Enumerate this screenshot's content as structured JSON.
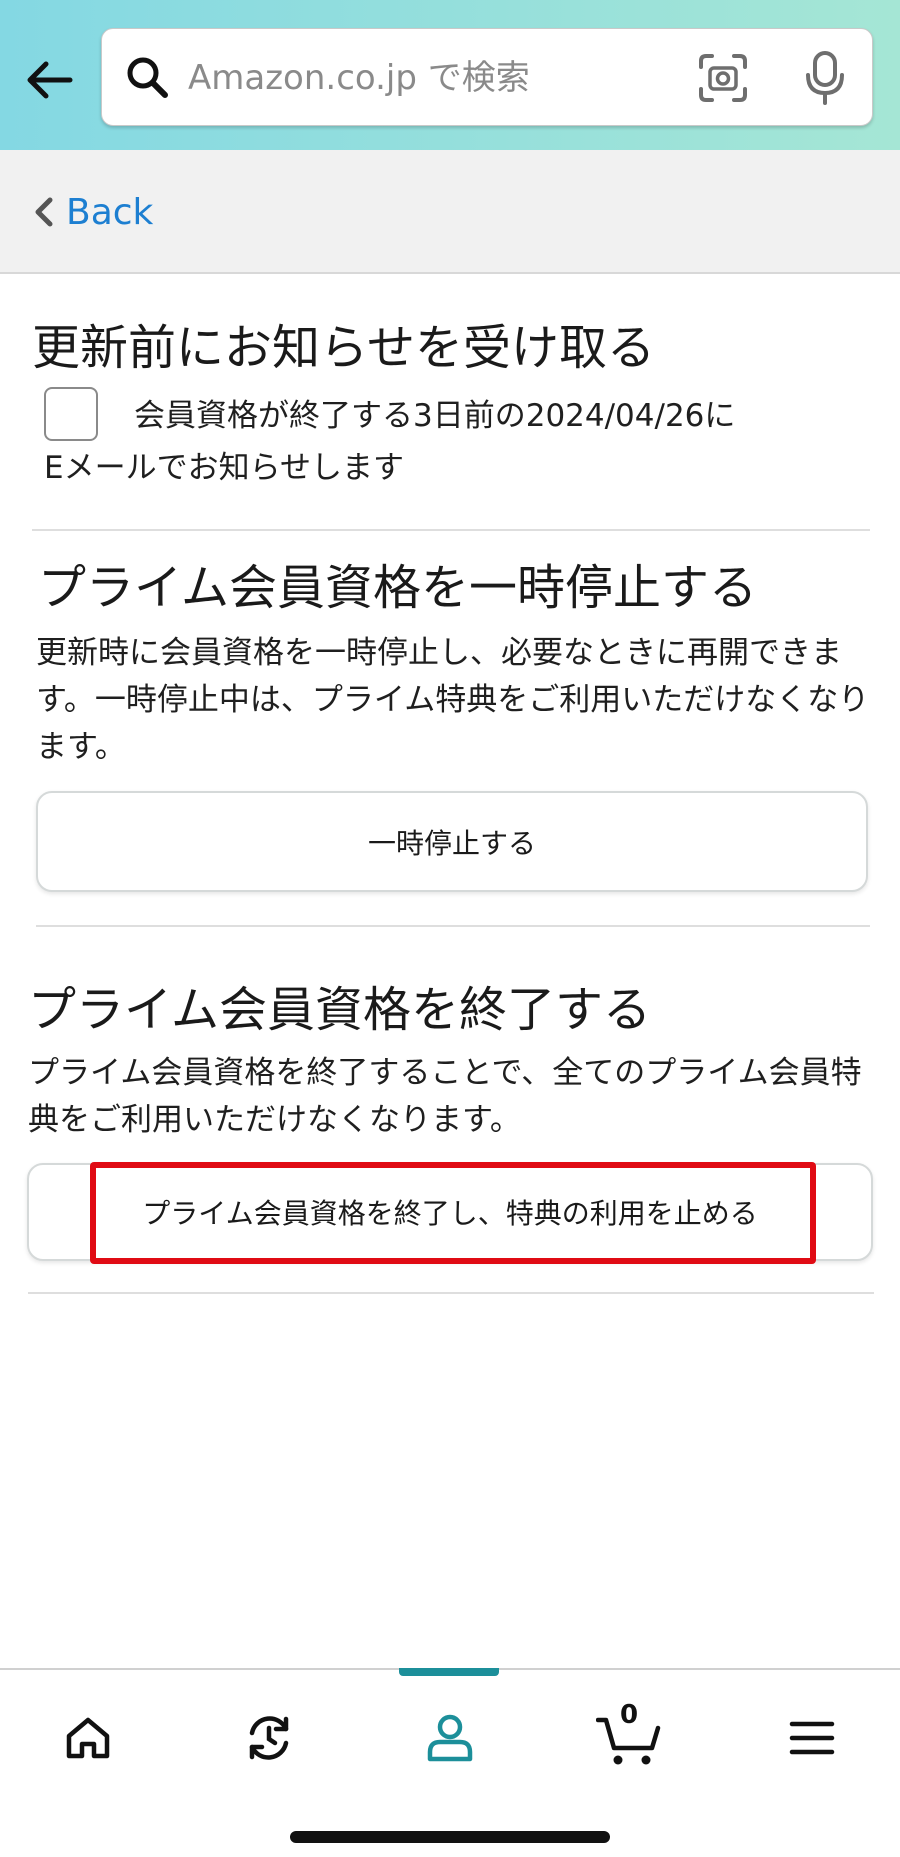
{
  "header": {
    "search_placeholder": "Amazon.co.jp で検索"
  },
  "back_bar": {
    "back_label": "Back"
  },
  "notify_section": {
    "title": "更新前にお知らせを受け取る",
    "checkbox_line1": "会員資格が終了する3日前の2024/04/26に",
    "checkbox_line2": "Eメールでお知らせします",
    "checked": false
  },
  "pause_section": {
    "title": "プライム会員資格を一時停止する",
    "description": "更新時に会員資格を一時停止し、必要なときに再開できます。一時停止中は、プライム特典をご利用いただけなくなります。",
    "button_label": "一時停止する"
  },
  "end_section": {
    "title": "プライム会員資格を終了する",
    "description": "プライム会員資格を終了することで、全てのプライム会員特典をご利用いただけなくなります。",
    "button_label": "プライム会員資格を終了し、特典の利用を止める",
    "highlight_color": "#e00b14"
  },
  "bottom_nav": {
    "items": [
      "home-icon",
      "history-icon",
      "account-icon",
      "cart-icon",
      "menu-icon"
    ],
    "active": "account-icon",
    "cart_count": "0",
    "accent_color": "#1c8f9a"
  }
}
